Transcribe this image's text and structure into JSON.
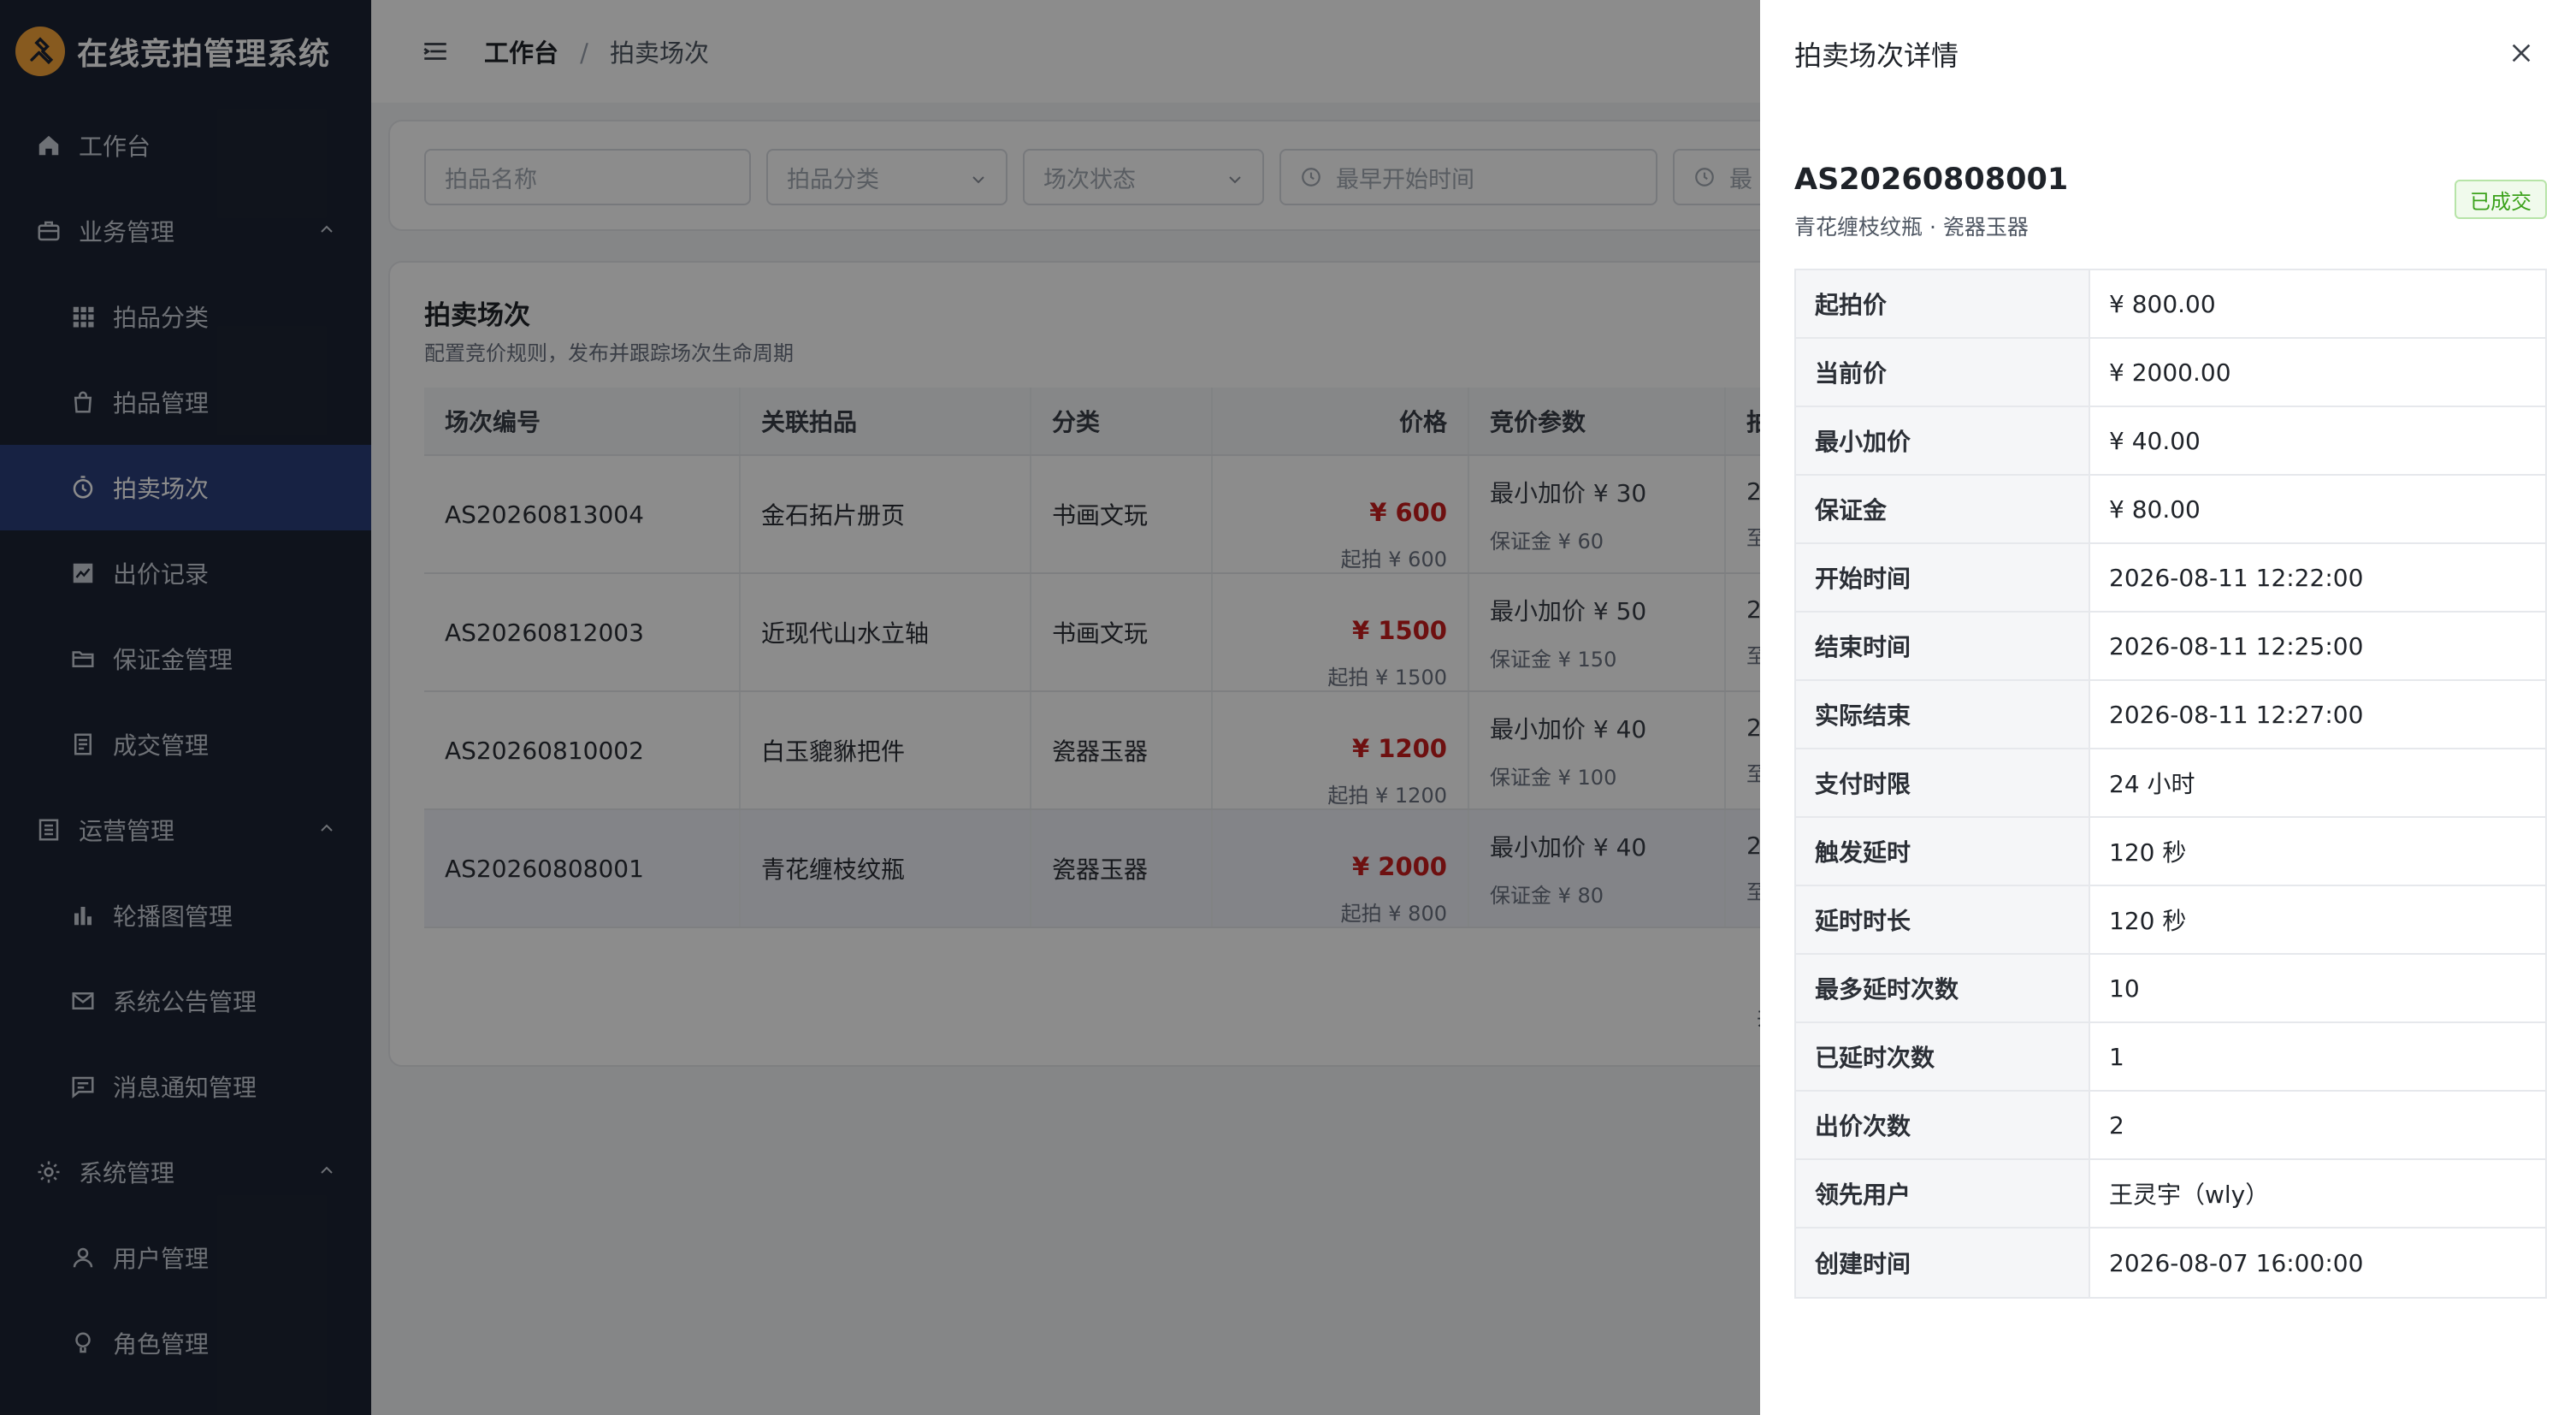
{
  "brand": {
    "title": "在线竞拍管理系统"
  },
  "sidebar": {
    "items": [
      {
        "label": "工作台",
        "icon": "home-icon",
        "level": "top"
      },
      {
        "label": "业务管理",
        "icon": "briefcase-icon",
        "level": "top",
        "expanded": true
      },
      {
        "label": "拍品分类",
        "icon": "grid-icon",
        "level": "sub"
      },
      {
        "label": "拍品管理",
        "icon": "bag-icon",
        "level": "sub"
      },
      {
        "label": "拍卖场次",
        "icon": "timer-icon",
        "level": "sub",
        "active": true
      },
      {
        "label": "出价记录",
        "icon": "chart-icon",
        "level": "sub"
      },
      {
        "label": "保证金管理",
        "icon": "folder-icon",
        "level": "sub"
      },
      {
        "label": "成交管理",
        "icon": "document-icon",
        "level": "sub"
      },
      {
        "label": "运营管理",
        "icon": "list-icon",
        "level": "top",
        "expanded": true
      },
      {
        "label": "轮播图管理",
        "icon": "bar-chart-icon",
        "level": "sub"
      },
      {
        "label": "系统公告管理",
        "icon": "mail-icon",
        "level": "sub"
      },
      {
        "label": "消息通知管理",
        "icon": "message-icon",
        "level": "sub"
      },
      {
        "label": "系统管理",
        "icon": "gear-icon",
        "level": "top",
        "expanded": true
      },
      {
        "label": "用户管理",
        "icon": "user-icon",
        "level": "sub"
      },
      {
        "label": "角色管理",
        "icon": "bulb-icon",
        "level": "sub"
      }
    ]
  },
  "breadcrumb": {
    "home": "工作台",
    "separator": "/",
    "current": "拍卖场次"
  },
  "filters": {
    "name_placeholder": "拍品名称",
    "category_placeholder": "拍品分类",
    "status_placeholder": "场次状态",
    "start_placeholder": "最早开始时间",
    "end_placeholder": "最"
  },
  "table": {
    "title": "拍卖场次",
    "subtitle": "配置竞价规则，发布并跟踪场次生命周期",
    "columns": [
      "场次编号",
      "关联拍品",
      "分类",
      "价格",
      "竞价参数",
      "拍"
    ],
    "rows": [
      {
        "no": "AS20260813004",
        "item": "金石拓片册页",
        "category": "书画文玩",
        "price": "¥ 600",
        "start": "起拍 ¥ 600",
        "min_inc": "最小加价 ¥ 30",
        "deposit": "保证金 ¥ 60",
        "more1": "2",
        "more2": "至"
      },
      {
        "no": "AS20260812003",
        "item": "近现代山水立轴",
        "category": "书画文玩",
        "price": "¥ 1500",
        "start": "起拍 ¥ 1500",
        "min_inc": "最小加价 ¥ 50",
        "deposit": "保证金 ¥ 150",
        "more1": "2",
        "more2": "至"
      },
      {
        "no": "AS20260810002",
        "item": "白玉貔貅把件",
        "category": "瓷器玉器",
        "price": "¥ 1200",
        "start": "起拍 ¥ 1200",
        "min_inc": "最小加价 ¥ 40",
        "deposit": "保证金 ¥ 100",
        "more1": "2",
        "more2": "至"
      },
      {
        "no": "AS20260808001",
        "item": "青花缠枝纹瓶",
        "category": "瓷器玉器",
        "price": "¥ 2000",
        "start": "起拍 ¥ 800",
        "min_inc": "最小加价 ¥ 40",
        "deposit": "保证金 ¥ 80",
        "more1": "2",
        "more2": "至",
        "selected": true
      }
    ],
    "pager_partial": "共"
  },
  "drawer": {
    "title": "拍卖场次详情",
    "code": "AS20260808001",
    "subtitle": "青花缠枝纹瓶 · 瓷器玉器",
    "badge": "已成交",
    "fields": [
      {
        "label": "起拍价",
        "value": "¥ 800.00"
      },
      {
        "label": "当前价",
        "value": "¥ 2000.00"
      },
      {
        "label": "最小加价",
        "value": "¥ 40.00"
      },
      {
        "label": "保证金",
        "value": "¥ 80.00"
      },
      {
        "label": "开始时间",
        "value": "2026-08-11 12:22:00"
      },
      {
        "label": "结束时间",
        "value": "2026-08-11 12:25:00"
      },
      {
        "label": "实际结束",
        "value": "2026-08-11 12:27:00"
      },
      {
        "label": "支付时限",
        "value": "24 小时"
      },
      {
        "label": "触发延时",
        "value": "120 秒"
      },
      {
        "label": "延时时长",
        "value": "120 秒"
      },
      {
        "label": "最多延时次数",
        "value": "10"
      },
      {
        "label": "已延时次数",
        "value": "1"
      },
      {
        "label": "出价次数",
        "value": "2"
      },
      {
        "label": "领先用户",
        "value": "王灵宇（wly）"
      },
      {
        "label": "创建时间",
        "value": "2026-08-07 16:00:00"
      }
    ]
  },
  "colors": {
    "sidebar_bg": "#1d2433",
    "active_bg": "#2b3f7a",
    "price_red": "#c81e1e",
    "badge_green": "#3ba21b",
    "logo_orange": "#f6a43a"
  }
}
